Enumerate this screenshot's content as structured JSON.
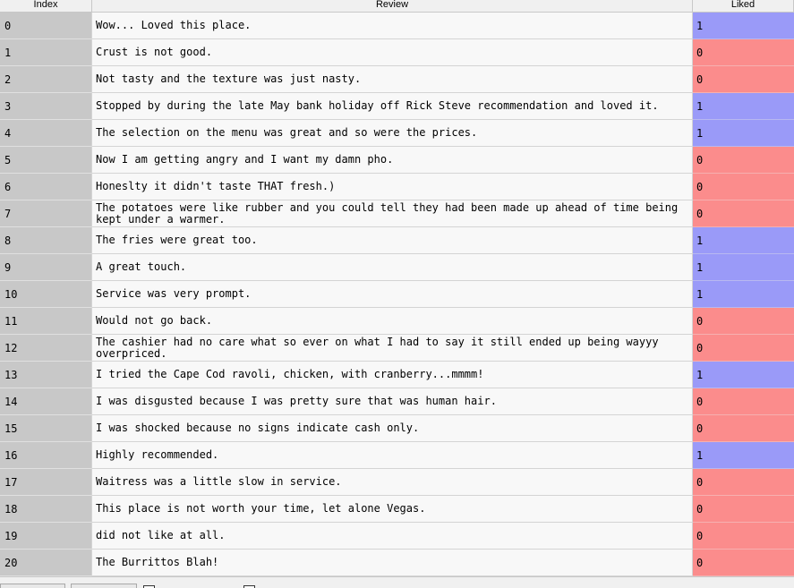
{
  "columns": {
    "index": "Index",
    "review": "Review",
    "liked": "Liked"
  },
  "colors": {
    "liked_1": "#9a9af8",
    "liked_0": "#fb8c8c",
    "index_bg": "#c8c8c8"
  },
  "rows": [
    {
      "index": "0",
      "review": "Wow... Loved this place.",
      "liked": "1"
    },
    {
      "index": "1",
      "review": "Crust is not good.",
      "liked": "0"
    },
    {
      "index": "2",
      "review": "Not tasty and the texture was just nasty.",
      "liked": "0"
    },
    {
      "index": "3",
      "review": "Stopped by during the late May bank holiday off Rick Steve recommendation and loved it.",
      "liked": "1"
    },
    {
      "index": "4",
      "review": "The selection on the menu was great and so were the prices.",
      "liked": "1"
    },
    {
      "index": "5",
      "review": "Now I am getting angry and I want my damn pho.",
      "liked": "0"
    },
    {
      "index": "6",
      "review": "Honeslty it didn't taste THAT fresh.)",
      "liked": "0"
    },
    {
      "index": "7",
      "review": "The potatoes were like rubber and you could tell they had been made up ahead of time being kept under a warmer.",
      "liked": "0"
    },
    {
      "index": "8",
      "review": "The fries were great too.",
      "liked": "1"
    },
    {
      "index": "9",
      "review": "A great touch.",
      "liked": "1"
    },
    {
      "index": "10",
      "review": "Service was very prompt.",
      "liked": "1"
    },
    {
      "index": "11",
      "review": "Would not go back.",
      "liked": "0"
    },
    {
      "index": "12",
      "review": "The cashier had no care what so ever on what I had to say it still ended up being wayyy overpriced.",
      "liked": "0"
    },
    {
      "index": "13",
      "review": "I tried the Cape Cod ravoli, chicken, with cranberry...mmmm!",
      "liked": "1"
    },
    {
      "index": "14",
      "review": "I was disgusted because I was pretty sure that was human hair.",
      "liked": "0"
    },
    {
      "index": "15",
      "review": "I was shocked because no signs indicate cash only.",
      "liked": "0"
    },
    {
      "index": "16",
      "review": "Highly recommended.",
      "liked": "1"
    },
    {
      "index": "17",
      "review": "Waitress was a little slow in service.",
      "liked": "0"
    },
    {
      "index": "18",
      "review": "This place is not worth your time, let alone Vegas.",
      "liked": "0"
    },
    {
      "index": "19",
      "review": "did not like at all.",
      "liked": "0"
    },
    {
      "index": "20",
      "review": "The Burrittos Blah!",
      "liked": "0"
    }
  ]
}
